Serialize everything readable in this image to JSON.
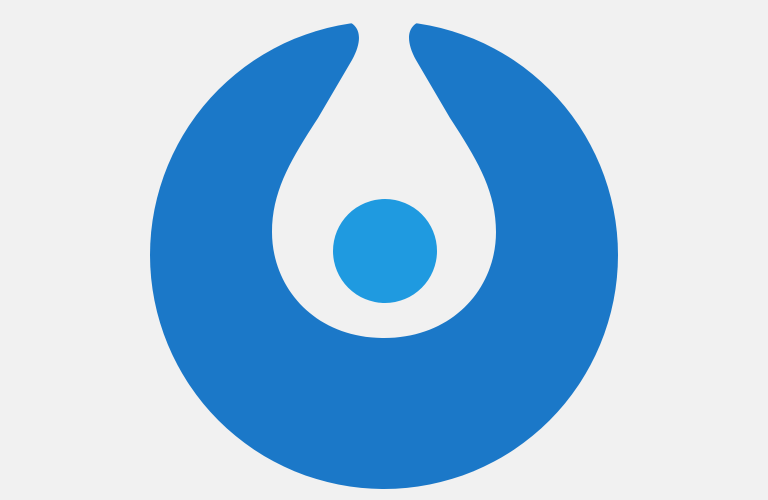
{
  "logo": {
    "name": "drop-in-circle-logo",
    "colors": {
      "background": "#f1f1f1",
      "ring": "#1b78c8",
      "dot": "#1f9ae0",
      "cutout": "#f1f1f1"
    }
  }
}
